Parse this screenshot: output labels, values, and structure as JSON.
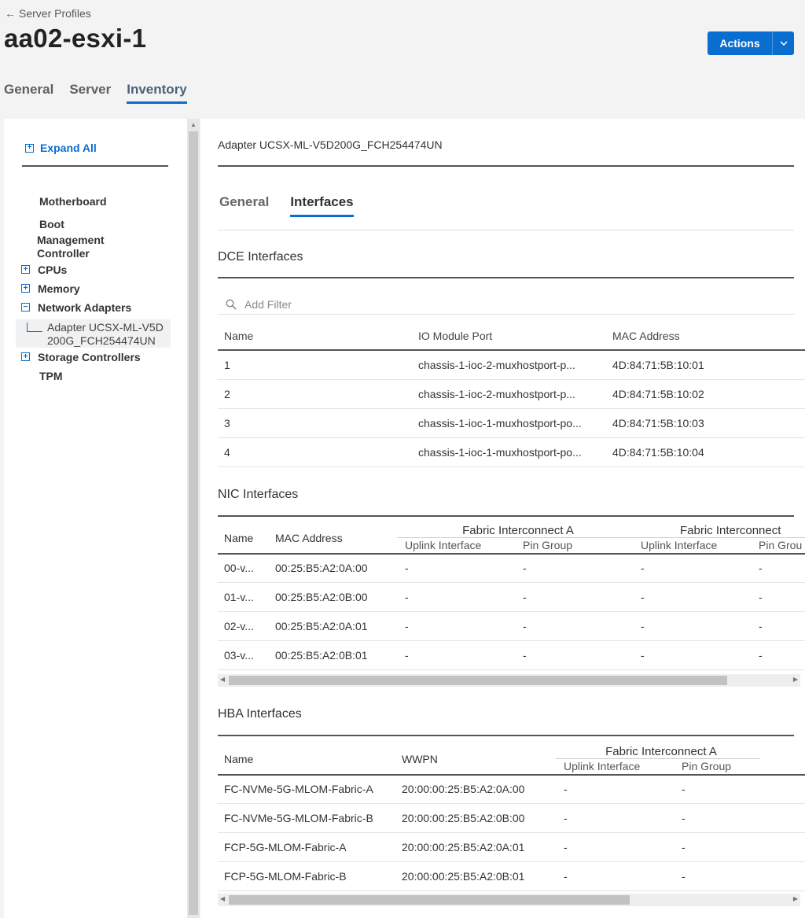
{
  "header": {
    "back_label": "Server Profiles",
    "title": "aa02-esxi-1",
    "actions_label": "Actions"
  },
  "top_tabs": [
    "General",
    "Server",
    "Inventory"
  ],
  "tree": {
    "expand_all": "Expand All",
    "items": [
      {
        "label": "Motherboard",
        "toggle": "none"
      },
      {
        "label": "Boot",
        "toggle": "none"
      },
      {
        "label": "Management Controller",
        "toggle": "none"
      },
      {
        "label": "CPUs",
        "toggle": "plus"
      },
      {
        "label": "Memory",
        "toggle": "plus"
      },
      {
        "label": "Network Adapters",
        "toggle": "minus"
      },
      {
        "label": "Storage Controllers",
        "toggle": "plus"
      },
      {
        "label": "TPM",
        "toggle": "none"
      }
    ],
    "selected_child": "Adapter UCSX-ML-V5D200G_FCH254474UN"
  },
  "content": {
    "adapter_title": "Adapter UCSX-ML-V5D200G_FCH254474UN",
    "sub_tabs": [
      "General",
      "Interfaces"
    ],
    "dce": {
      "title": "DCE Interfaces",
      "filter_placeholder": "Add Filter",
      "columns": [
        "Name",
        "IO Module Port",
        "MAC Address"
      ],
      "rows": [
        [
          "1",
          "chassis-1-ioc-2-muxhostport-p...",
          "4D:84:71:5B:10:01"
        ],
        [
          "2",
          "chassis-1-ioc-2-muxhostport-p...",
          "4D:84:71:5B:10:02"
        ],
        [
          "3",
          "chassis-1-ioc-1-muxhostport-po...",
          "4D:84:71:5B:10:03"
        ],
        [
          "4",
          "chassis-1-ioc-1-muxhostport-po...",
          "4D:84:71:5B:10:04"
        ]
      ]
    },
    "nic": {
      "title": "NIC Interfaces",
      "columns": [
        "Name",
        "MAC Address"
      ],
      "group_a": "Fabric Interconnect A",
      "group_b": "Fabric Interconnect",
      "sub_columns": [
        "Uplink Interface",
        "Pin Group"
      ],
      "sub_column_b2": "Pin Grou",
      "rows": [
        [
          "00-v...",
          "00:25:B5:A2:0A:00",
          "-",
          "-",
          "-",
          "-"
        ],
        [
          "01-v...",
          "00:25:B5:A2:0B:00",
          "-",
          "-",
          "-",
          "-"
        ],
        [
          "02-v...",
          "00:25:B5:A2:0A:01",
          "-",
          "-",
          "-",
          "-"
        ],
        [
          "03-v...",
          "00:25:B5:A2:0B:01",
          "-",
          "-",
          "-",
          "-"
        ]
      ]
    },
    "hba": {
      "title": "HBA Interfaces",
      "columns": [
        "Name",
        "WWPN"
      ],
      "group_a": "Fabric Interconnect A",
      "sub_columns": [
        "Uplink Interface",
        "Pin Group"
      ],
      "rows": [
        [
          "FC-NVMe-5G-MLOM-Fabric-A",
          "20:00:00:25:B5:A2:0A:00",
          "-",
          "-"
        ],
        [
          "FC-NVMe-5G-MLOM-Fabric-B",
          "20:00:00:25:B5:A2:0B:00",
          "-",
          "-"
        ],
        [
          "FCP-5G-MLOM-Fabric-A",
          "20:00:00:25:B5:A2:0A:01",
          "-",
          "-"
        ],
        [
          "FCP-5G-MLOM-Fabric-B",
          "20:00:00:25:B5:A2:0B:01",
          "-",
          "-"
        ]
      ]
    }
  }
}
